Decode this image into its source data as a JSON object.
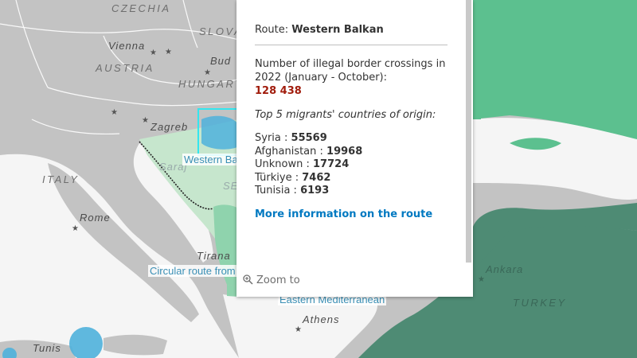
{
  "map": {
    "countries": {
      "czechia": "CZECHIA",
      "slovakia_partial": "SLOVA",
      "austria": "AUSTRIA",
      "hungary": "HUNGARY",
      "italy": "ITALY",
      "turkey": "TURKEY"
    },
    "cities": {
      "vienna": "Vienna",
      "zagreb": "Zagreb",
      "rome": "Rome",
      "tirana": "Tirana",
      "athens": "Athens",
      "tunis": "Tunis",
      "ankara": "Ankara",
      "budapest_partial": "Bud",
      "sarajevo_partial": "Saraj",
      "serbia_partial": "SE"
    },
    "route_labels": {
      "western_balkan": "Western Ba",
      "circular": "Circular route from",
      "eastern_med": "Eastern Mediterranean"
    },
    "colors": {
      "land_gray": "#c3c3c3",
      "sea_white": "#f5f5f5",
      "balkan_green": "#c6e6cd",
      "light_green": "#8fd3ad",
      "mid_green": "#5cc08f",
      "dark_green": "#4e8b74",
      "route_blue": "#4fb1dc",
      "highlight_cyan": "#33e6ef"
    }
  },
  "popup": {
    "route_prefix": "Route:",
    "route_name": "Western Balkan",
    "crossings_text": "Number of illegal border crossings in 2022 (January - October):",
    "crossings_value": "128 438",
    "origin_heading": "Top 5 migrants' countries of origin:",
    "origins": [
      {
        "country": "Syria",
        "value": "55569"
      },
      {
        "country": "Afghanistan",
        "value": "19968"
      },
      {
        "country": "Unknown",
        "value": "17724"
      },
      {
        "country": "Türkiye",
        "value": "7462"
      },
      {
        "country": "Tunisia",
        "value": "6193"
      }
    ],
    "more_link": "More information on the route",
    "zoom_to": "Zoom to",
    "colors": {
      "value_red": "#a11d0d",
      "link_blue": "#0079c1"
    }
  }
}
